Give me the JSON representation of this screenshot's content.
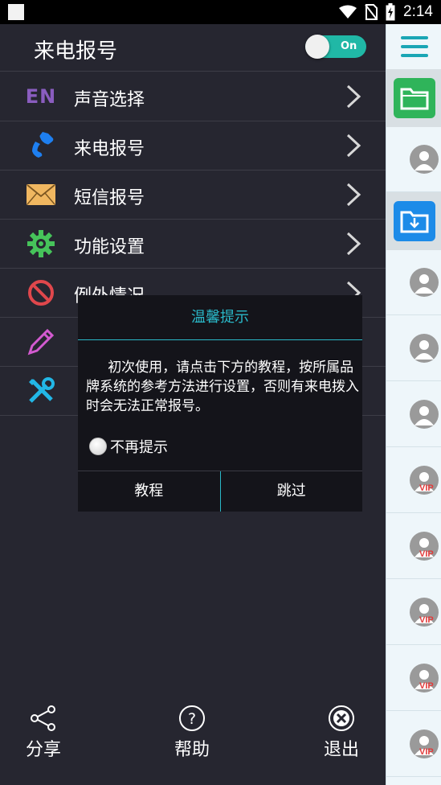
{
  "status_bar": {
    "time": "2:14",
    "icons": [
      "wifi-icon",
      "no-sim-icon",
      "battery-charging-icon"
    ]
  },
  "drawer": {
    "title": "来电报号",
    "toggle_label": "On",
    "toggle_state": "on",
    "menu": [
      {
        "label": "声音选择",
        "icon": "en-language-icon",
        "icon_text": "EN"
      },
      {
        "label": "来电报号",
        "icon": "phone-icon"
      },
      {
        "label": "短信报号",
        "icon": "envelope-icon"
      },
      {
        "label": "功能设置",
        "icon": "gear-icon"
      },
      {
        "label": "例外情况",
        "icon": "forbidden-icon"
      },
      {
        "label": "",
        "icon": "pencil-icon"
      },
      {
        "label": "",
        "icon": "tools-icon"
      }
    ],
    "bottom": {
      "share": "分享",
      "help": "帮助",
      "exit": "退出"
    }
  },
  "dialog": {
    "title": "温馨提示",
    "message": "初次使用，请点击下方的教程，按所属品牌系统的参考方法进行设置，否则有来电拨入时会无法正常报号。",
    "checkbox_label": "不再提示",
    "checkbox_checked": false,
    "tutorial_button": "教程",
    "skip_button": "跳过"
  },
  "sidebar": {
    "contacts": [
      {
        "vip": false
      },
      {
        "vip": false
      },
      {
        "vip": false
      },
      {
        "vip": false
      },
      {
        "vip": true,
        "badge": "VIP"
      },
      {
        "vip": true,
        "badge": "VIP"
      },
      {
        "vip": true,
        "badge": "VIP"
      },
      {
        "vip": true,
        "badge": "VIP"
      },
      {
        "vip": true,
        "badge": "VIP"
      }
    ]
  },
  "colors": {
    "accent": "#2ab8c8",
    "toggle_on": "#20b8a6",
    "panel_bg": "#262630",
    "dialog_bg": "#14141a",
    "sidebar_bg": "#eef6fa"
  }
}
